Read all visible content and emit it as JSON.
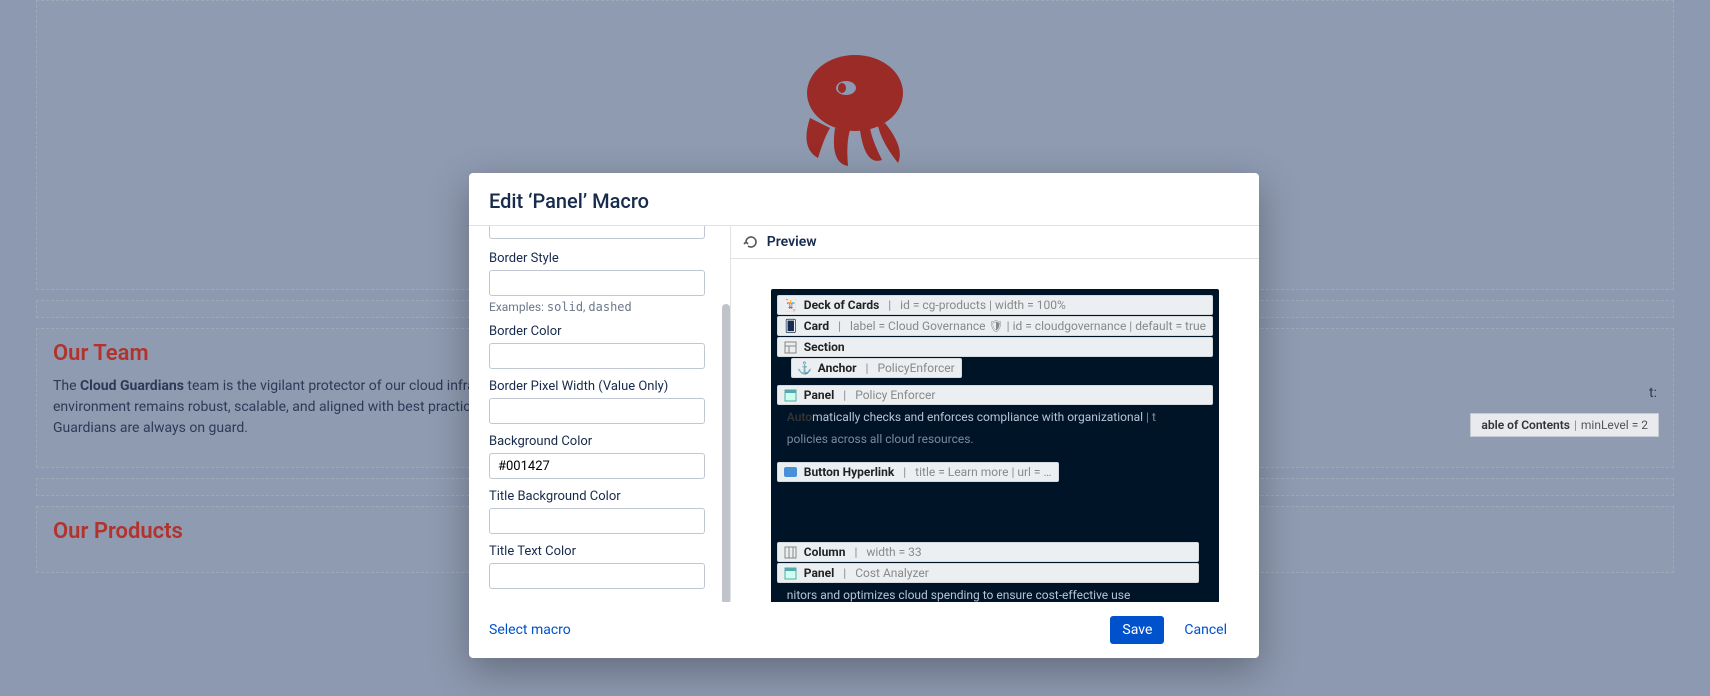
{
  "page": {
    "team_heading": "Our Team",
    "products_heading": "Our Products",
    "team_strong": "Cloud Guardians",
    "team_text_pre": "The ",
    "team_text_post_1": " team is the vigilant protector of our cloud infrastru",
    "team_text_line2": "environment remains robust, scalable, and aligned with best practices. W",
    "team_text_line3": "Guardians are always on guard.",
    "team_trail_t": "t:",
    "toc_label": "able of Contents",
    "toc_params": "minLevel = 2"
  },
  "modal": {
    "title": "Edit ‘Panel’ Macro",
    "select_macro": "Select macro",
    "save": "Save",
    "cancel": "Cancel",
    "preview_label": "Preview",
    "fields": {
      "border_style": {
        "label": "Border Style",
        "value": "",
        "help_pre": "Examples: ",
        "help_code1": "solid",
        "help_sep": ", ",
        "help_code2": "dashed"
      },
      "border_color": {
        "label": "Border Color",
        "value": ""
      },
      "border_px": {
        "label": "Border Pixel Width (Value Only)",
        "value": ""
      },
      "bg_color": {
        "label": "Background Color",
        "value": "#001427"
      },
      "title_bg": {
        "label": "Title Background Color",
        "value": ""
      },
      "title_text": {
        "label": "Title Text Color",
        "value": ""
      }
    }
  },
  "preview": {
    "deck": {
      "name": "Deck of Cards",
      "params": "id = cg-products  |  width = 100%"
    },
    "card": {
      "name": "Card",
      "params": "label = Cloud Governance 🛡  |  id = cloudgovernance  |  default = true"
    },
    "section": {
      "name": "Section"
    },
    "anchor": {
      "name": "Anchor",
      "params": "PolicyEnforcer"
    },
    "panel1": {
      "name": "Panel",
      "params": "Policy Enforcer"
    },
    "overlay_bold": "Auto",
    "overlay_rest": "matically checks and enforces compliance with organizational",
    "overlay_trail": " | t",
    "line2": "policies across all cloud resources.",
    "button": {
      "name": "Button Hyperlink",
      "params": "title = Learn more  |  url = …"
    },
    "column": {
      "name": "Column",
      "params": "width = 33"
    },
    "panel2": {
      "name": "Panel",
      "params": "Cost Analyzer"
    },
    "cutoff": "nitors and optimizes cloud spending to ensure cost-effective use"
  }
}
